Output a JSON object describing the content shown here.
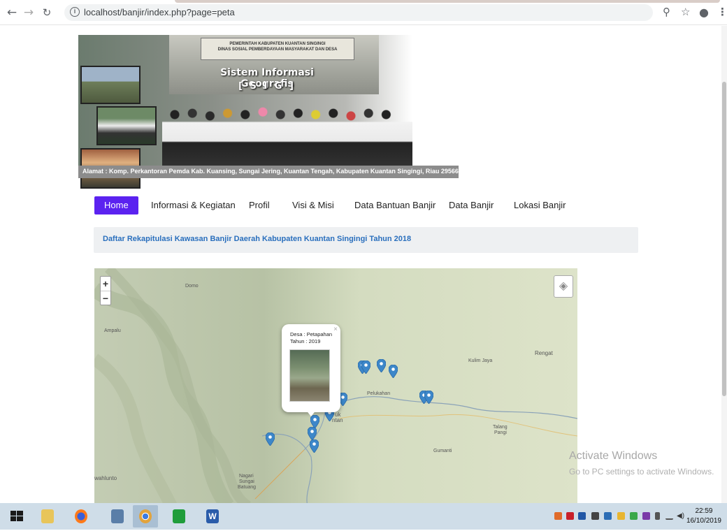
{
  "browser": {
    "url": "localhost/banjir/index.php?page=peta",
    "icons": [
      "back-icon",
      "forward-icon",
      "reload-icon",
      "info-icon",
      "zoom-icon",
      "star-icon",
      "account-icon",
      "menu-icon"
    ]
  },
  "banner": {
    "sign_line1": "PEMERINTAH KABUPATEN KUANTAN SINGINGI",
    "sign_line2": "DINAS SOSIAL PEMBERDAYAAN MASYARAKAT DAN DESA",
    "title": "Sistem Informasi Geografis",
    "subtitle": "[ S I G ]",
    "address": "Alamat : Komp. Perkantoran Pemda Kab. Kuansing, Sungai Jering, Kuantan Tengah, Kabupaten Kuantan Singingi, Riau 29566"
  },
  "nav": {
    "items": [
      {
        "label": "Home",
        "active": true
      },
      {
        "label": "Informasi & Kegiatan"
      },
      {
        "label": "Profil"
      },
      {
        "label": "Visi & Misi"
      },
      {
        "label": "Data Bantuan Banjir"
      },
      {
        "label": "Data Banjir"
      },
      {
        "label": "Lokasi Banjir"
      }
    ]
  },
  "info": {
    "text": "Daftar Rekapitulasi Kawasan Banjir Daerah Kabupaten Kuantan Singingi Tahun 2018"
  },
  "map": {
    "zoom_in": "+",
    "zoom_out": "−",
    "labels": {
      "domo": "Domo",
      "ampalu": "Ampalu",
      "rengat": "Rengat",
      "kulim_jaya": "Kulim Jaya",
      "pelukahan": "Pelukahan",
      "talang": "Talang",
      "pangi": "Pangi",
      "gumanti": "Gumanti",
      "wahlunto": "wahlunto",
      "nagari": "Nagari",
      "sungai": "Sungai",
      "batuang": "Batuang",
      "teluk": "uk",
      "kuantan": "ntan"
    },
    "popup": {
      "desa": "Desa : Petapahan",
      "tahun": "Tahun : 2019",
      "close": "×"
    },
    "marker_color": "#3d87c9"
  },
  "watermark": {
    "line1": "Activate Windows",
    "line2": "Go to PC settings to activate Windows."
  },
  "taskbar": {
    "time": "22:59",
    "date": "16/10/2019"
  }
}
